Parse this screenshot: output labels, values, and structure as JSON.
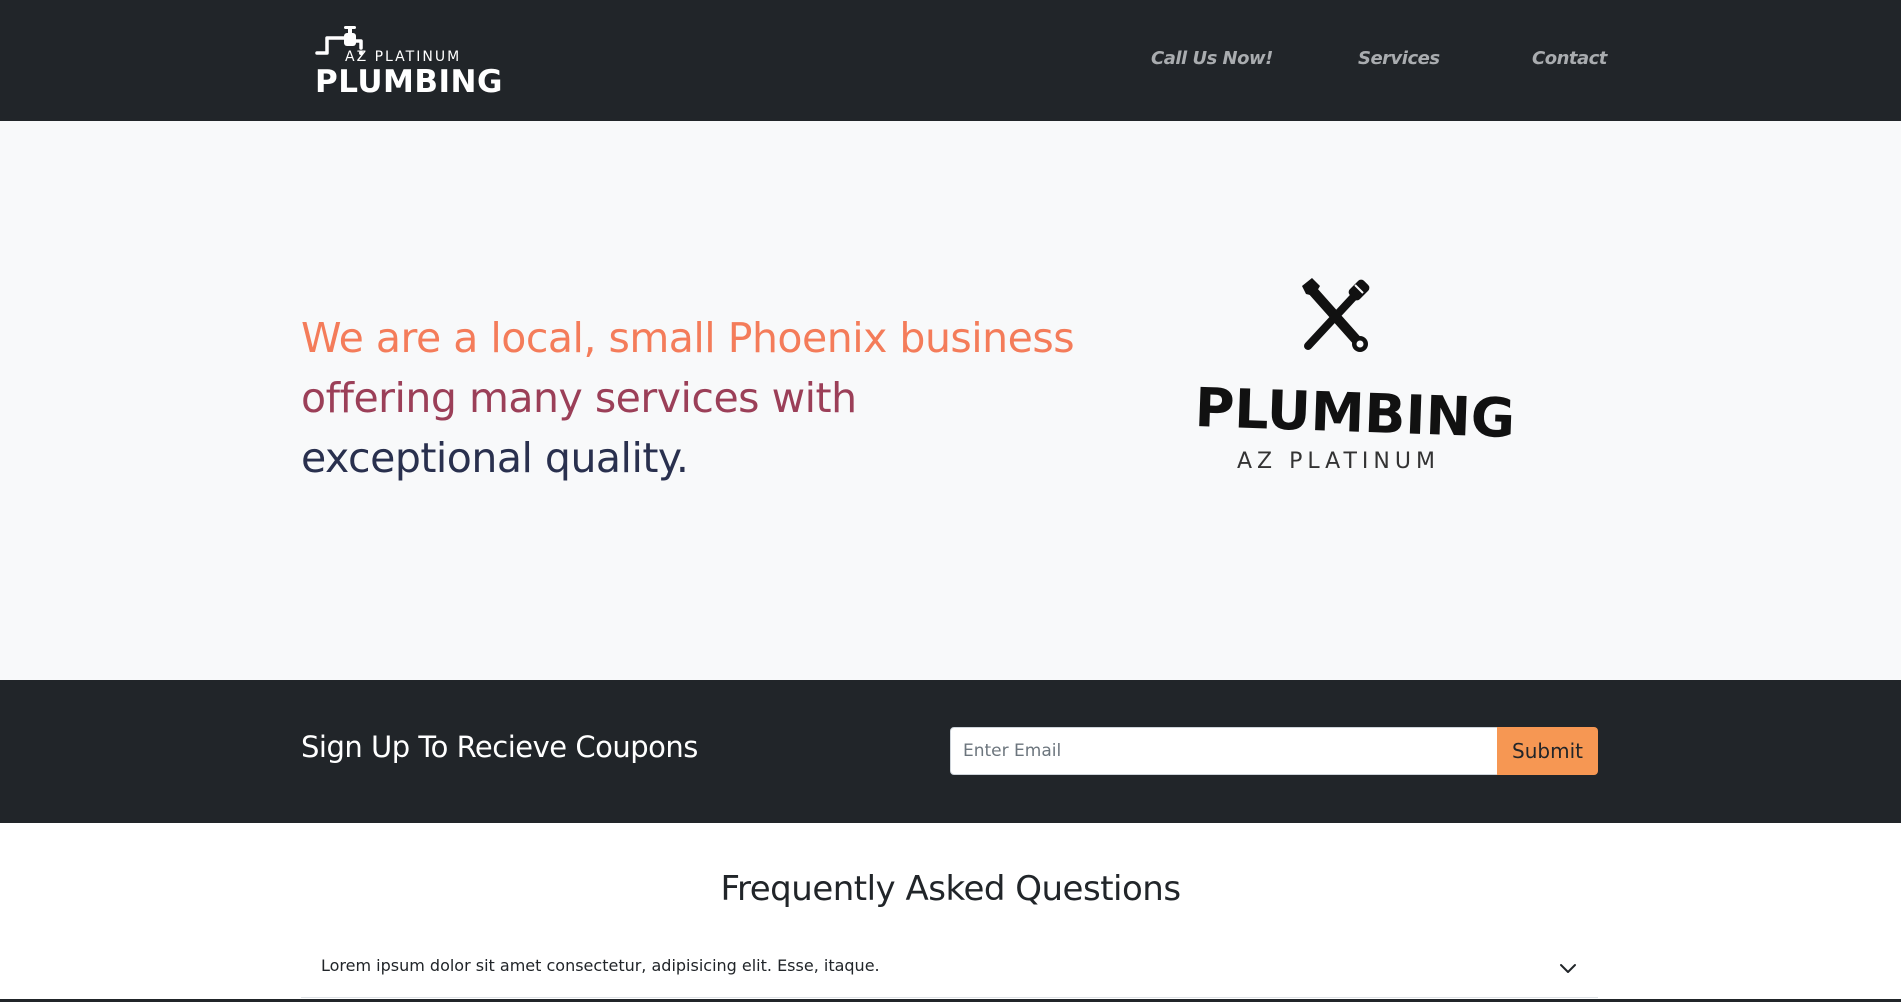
{
  "nav": {
    "brand_top": "AZ PLATINUM",
    "brand_main": "PLUMBING",
    "links": [
      "Call Us Now!",
      "Services",
      "Contact"
    ]
  },
  "hero": {
    "line1": "We are a local, small Phoenix business",
    "line2": "offering many services with",
    "line3": "exceptional quality.",
    "logo_word": "PLUMBING",
    "logo_sub": "AZ PLATINUM"
  },
  "signup": {
    "title": "Sign Up To Recieve Coupons",
    "email_placeholder": "Enter Email",
    "email_value": "",
    "submit_label": "Submit"
  },
  "faq": {
    "title": "Frequently Asked Questions",
    "items": [
      {
        "question": "Lorem ipsum dolor sit amet consectetur, adipisicing elit. Esse, itaque."
      }
    ]
  },
  "icons": {
    "faucet": "faucet-icon",
    "tools": "crossed-wrench-screwdriver-icon",
    "chevron": "chevron-down-icon"
  },
  "colors": {
    "dark_bg": "#212529",
    "hero_bg": "#f8f9fa",
    "accent_orange": "#f69753",
    "hero_line1": "#f47c5a",
    "hero_line2": "#9b3f58",
    "hero_line3": "#29304e",
    "nav_link": "#a9acaf"
  }
}
